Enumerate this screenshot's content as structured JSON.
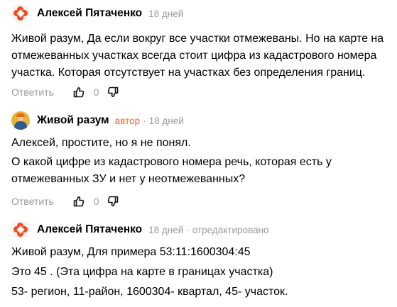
{
  "comments": [
    {
      "author": "Алексей Пятаченко",
      "time": "18 дней",
      "lines": [
        "Живой разум, Да если вокруг все участки отмежеваны. Но на карте на",
        "отмежеванных участках всегда стоит цифра из кадастрового номера",
        "участка. Которая отсутствует на участках без определения границ."
      ],
      "reply_label": "Ответить",
      "likes": "0"
    },
    {
      "author": "Живой разум",
      "badge": "автор",
      "separator": "·",
      "time": "18 дней",
      "lines": [
        "Алексей, простите, но я не понял.",
        "О какой цифре из кадастрового номера речь, которая есть у",
        "отмежеванных ЗУ и нет у неотмежеванных?"
      ],
      "reply_label": "Ответить",
      "likes": "0"
    },
    {
      "author": "Алексей Пятаченко",
      "time": "18 дней",
      "separator": "·",
      "edited": "отредактировано",
      "lines": [
        "Живой разум, Для примера 53:11:1600304:45",
        "Это 45 . (Эта цифра на карте в границах участка)",
        "53- регион, 11-район, 1600304- квартал, 45- участок."
      ]
    }
  ],
  "icons": {
    "avatar_1": "dzen-logo-avatar",
    "avatar_2": "user-photo-avatar",
    "avatar_3": "dzen-logo-avatar",
    "like": "thumbs-up-icon",
    "dislike": "thumbs-down-icon"
  },
  "colors": {
    "author_badge": "#f0641e",
    "meta": "#9a9a9a",
    "dzen_logo": "#f24a1d"
  }
}
